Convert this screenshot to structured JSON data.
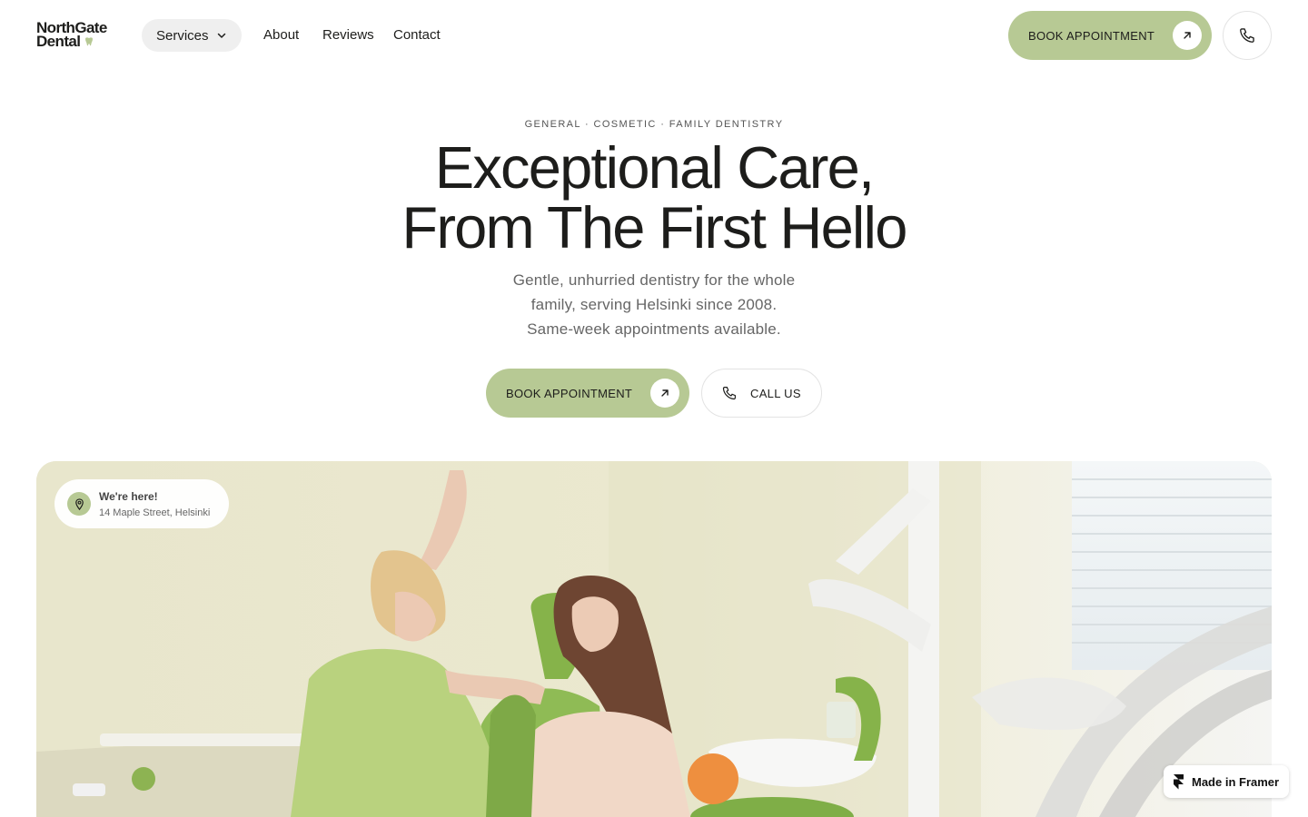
{
  "header": {
    "logo_line1": "NorthGate",
    "logo_line2": "Dental",
    "nav": {
      "services_label": "Services",
      "about_label": "About",
      "reviews_label": "Reviews",
      "contact_label": "Contact"
    },
    "book_label": "BOOK APPOINTMENT"
  },
  "hero": {
    "eyebrow": "GENERAL · COSMETIC · FAMILY DENTISTRY",
    "headline_line1": "Exceptional Care,",
    "headline_line2": "From The First Hello",
    "subtitle_line1": "Gentle, unhurried dentistry for the whole",
    "subtitle_line2": "family, serving Helsinki since 2008.",
    "subtitle_line3": "Same-week appointments available.",
    "book_label": "BOOK APPOINTMENT",
    "call_label": "CALL US"
  },
  "location": {
    "title": "We're here!",
    "address": "14 Maple Street, Helsinki"
  },
  "badge": {
    "label": "Made in Framer"
  },
  "colors": {
    "accent": "#b7c994",
    "text": "#1d1d1b",
    "muted": "#666666",
    "pill_bg": "#efefef"
  },
  "icons": [
    "tooth-icon",
    "chevron-down-icon",
    "arrow-up-right-icon",
    "phone-icon",
    "map-pin-icon",
    "framer-icon"
  ]
}
